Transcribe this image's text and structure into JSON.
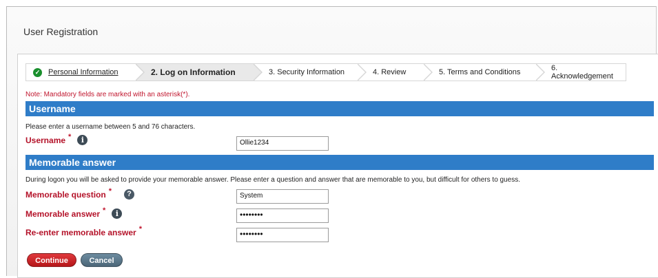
{
  "page": {
    "title": "User Registration"
  },
  "steps": [
    {
      "label": "Personal Information",
      "state": "done"
    },
    {
      "label": "2. Log on Information",
      "state": "active"
    },
    {
      "label": "3. Security Information",
      "state": "pending"
    },
    {
      "label": "4. Review",
      "state": "pending"
    },
    {
      "label": "5. Terms and Conditions",
      "state": "pending"
    },
    {
      "label": "6. Acknowledgement",
      "state": "pending"
    }
  ],
  "note": "Note: Mandatory fields are marked with an asterisk(*).",
  "username_section": {
    "heading": "Username",
    "description": "Please enter a username between 5 and 76 characters.",
    "field_label": "Username",
    "asterisk": "*",
    "value": "Ollie1234"
  },
  "memorable_section": {
    "heading": "Memorable answer",
    "description": "During logon you will be asked to provide your memorable answer. Please enter a question and answer that are memorable to you, but difficult for others to guess.",
    "question_label": "Memorable question",
    "question_value": "System",
    "answer_label": "Memorable answer",
    "answer_value": "••••••••",
    "reenter_label": "Re-enter memorable answer",
    "reenter_value": "••••••••",
    "asterisk": "*"
  },
  "buttons": {
    "continue": "Continue",
    "cancel": "Cancel"
  },
  "icons": {
    "info": "i",
    "help": "?",
    "check": "✓"
  },
  "colors": {
    "section_bar": "#2f7dc8",
    "label_red": "#b41229",
    "continue_red": "#c8242a",
    "cancel_slate": "#5a7486",
    "check_green": "#1a8f2d"
  }
}
